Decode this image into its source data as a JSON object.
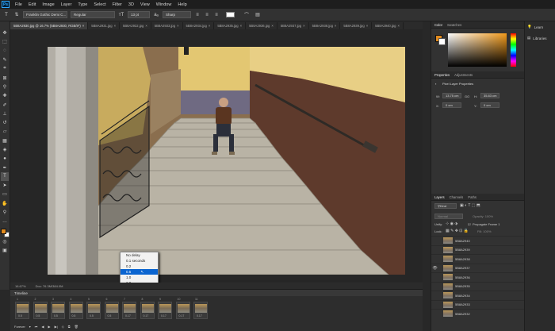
{
  "menubar": {
    "logo": "Ps",
    "items": [
      "File",
      "Edit",
      "Image",
      "Layer",
      "Type",
      "Select",
      "Filter",
      "3D",
      "View",
      "Window",
      "Help"
    ]
  },
  "options": {
    "type_tool": "T",
    "font_family": "Franklin Gothic Demi C...",
    "font_style": "Regular",
    "font_size": "13 pt",
    "anti_alias": "Sharp"
  },
  "tabs": [
    {
      "label": "5B8A2930.jpg @ 16.7% (5B8A2930, RGB/8*)",
      "active": true
    },
    {
      "label": "5B8A2931.jpg"
    },
    {
      "label": "5B8A2932.jpg"
    },
    {
      "label": "5B8A2933.jpg"
    },
    {
      "label": "5B8A2934.jpg"
    },
    {
      "label": "5B8A2935.jpg"
    },
    {
      "label": "5B8A2936.jpg"
    },
    {
      "label": "5B8A2937.jpg"
    },
    {
      "label": "5B8A2938.jpg"
    },
    {
      "label": "5B8A2939.jpg"
    },
    {
      "label": "5B8A2940.jpg"
    }
  ],
  "status": {
    "zoom": "16.67%",
    "doc": "Doc: 76.3M/384.0M"
  },
  "timeline": {
    "title": "Timeline",
    "frames": [
      {
        "num": "1",
        "delay": "0.5"
      },
      {
        "num": "2",
        "delay": "0.5"
      },
      {
        "num": "3",
        "delay": "0.5"
      },
      {
        "num": "4",
        "delay": "0.5"
      },
      {
        "num": "5",
        "delay": "0.5"
      },
      {
        "num": "6",
        "delay": "0.5"
      },
      {
        "num": "7",
        "delay": "0.17"
      },
      {
        "num": "8",
        "delay": "0.17"
      },
      {
        "num": "9",
        "delay": "0.17"
      },
      {
        "num": "10",
        "delay": "0.17"
      },
      {
        "num": "11",
        "delay": "0.17"
      }
    ],
    "loop": "Forever"
  },
  "delay_menu": {
    "items": [
      "No delay",
      "0.1 seconds",
      "0.2",
      "0.5",
      "1.0",
      "2.0",
      "5.0",
      "10.0"
    ],
    "highlighted": "0.5",
    "other": "Other...",
    "current": "0.17 seconds"
  },
  "panels": {
    "color_tabs": [
      "Color",
      "Swatches"
    ],
    "properties_tabs": [
      "Properties",
      "Adjustments"
    ],
    "properties_subtitle": "Pixel Layer Properties",
    "props": {
      "w_label": "W:",
      "w_val": "13.75 cm",
      "go_label": "GO",
      "h_label": "H:",
      "h_val": "35.83 cm",
      "x_label": "X:",
      "x_val": "0 cm",
      "y_label": "Y:",
      "y_val": "0 cm"
    },
    "layers_tabs": [
      "Layers",
      "Channels",
      "Paths"
    ],
    "kind": "Kind",
    "blend": "Normal",
    "opacity": "Opacity: 100%",
    "unify": "Unify:",
    "propagate": "Propagate Frame 1",
    "lock": "Lock:",
    "fill": "Fill: 100%",
    "layers": [
      "5B8A2940",
      "5B8A2939",
      "5B8A2938",
      "5B8A2937",
      "5B8A2936",
      "5B8A2935",
      "5B8A2934",
      "5B8A2933",
      "5B8A2932"
    ]
  },
  "dock": {
    "learn": "Learn",
    "libraries": "Libraries"
  },
  "colors": {
    "foreground": "#e08a1e",
    "background": "#ffffff",
    "highlight": "#0a64d0"
  }
}
